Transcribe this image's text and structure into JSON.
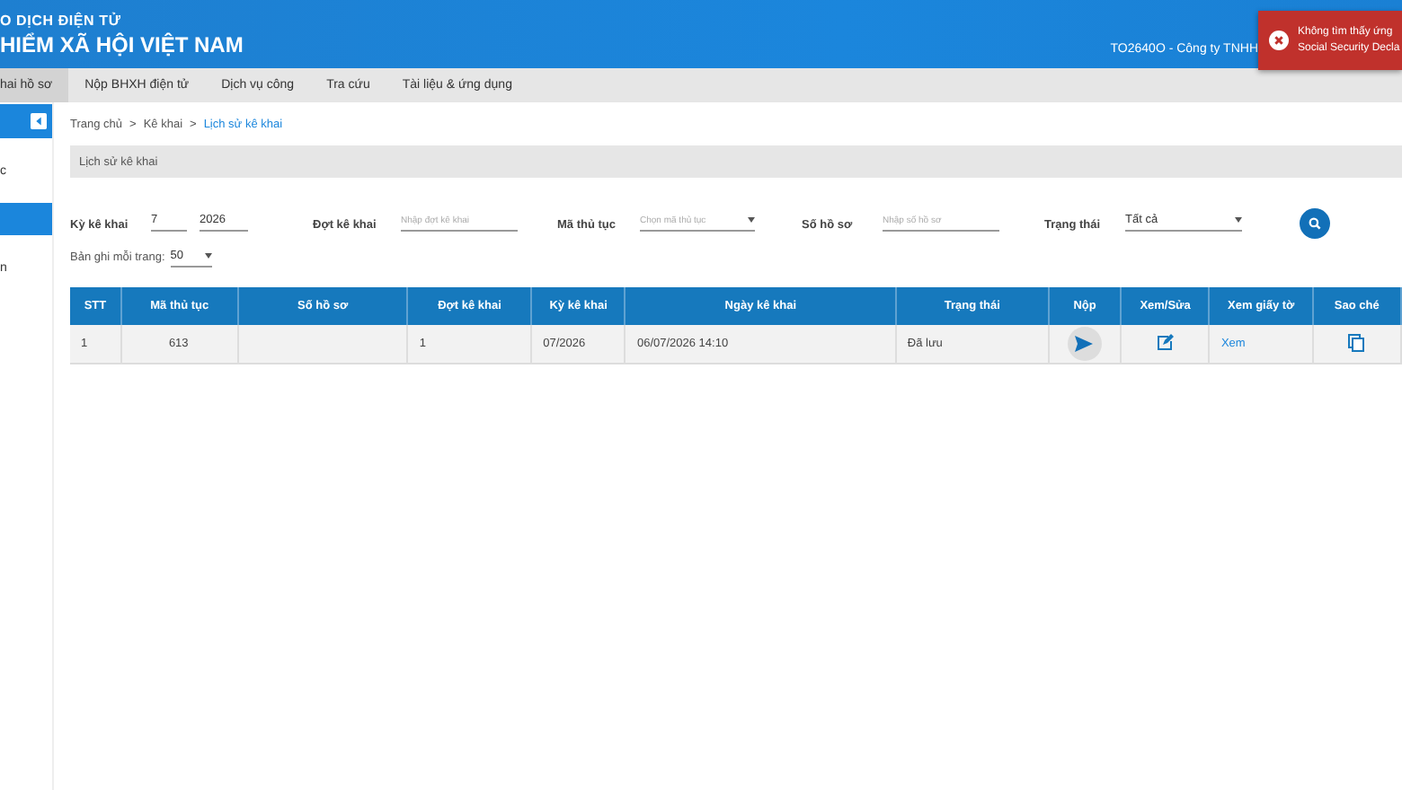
{
  "header": {
    "title_line_1": "O DỊCH ĐIỆN TỬ",
    "title_line_2": "HIỂM XÃ HỘI VIỆT NAM",
    "user": "TO2640O - Công ty TNHH"
  },
  "toast": {
    "line_1": "Không tìm thấy ứng",
    "line_2": "Social Security Decla"
  },
  "nav": [
    {
      "label": "hai hồ sơ",
      "selected": true
    },
    {
      "label": "Nộp BHXH điện tử",
      "selected": false
    },
    {
      "label": "Dịch vụ công",
      "selected": false
    },
    {
      "label": "Tra cứu",
      "selected": false
    },
    {
      "label": "Tài liệu & ứng dụng",
      "selected": false
    }
  ],
  "sidebar": {
    "items": [
      {
        "label": "c",
        "selected": false
      },
      {
        "selected": true
      },
      {
        "label": "n",
        "selected": false
      }
    ]
  },
  "breadcrumb": [
    {
      "label": "Trang chủ",
      "current": false
    },
    {
      "separator": ">",
      "label": "Kê khai",
      "current": false
    },
    {
      "separator": ">",
      "label": "Lịch sử kê khai",
      "current": true
    }
  ],
  "section_title": "Lịch sử kê khai",
  "filters": {
    "period_label": "Kỳ kê khai",
    "period_month": "7",
    "period_year": "2026",
    "batch_label": "Đợt kê khai",
    "batch_placeholder": "Nhập đợt kê khai",
    "procedure_label": "Mã thủ tục",
    "procedure_placeholder": "Chọn mã thủ tục",
    "file_label": "Số hồ sơ",
    "file_placeholder": "Nhập số hồ sơ",
    "status_label": "Trạng thái",
    "status_value": "Tất cả"
  },
  "page_size": {
    "label": "Bản ghi mỗi trang:",
    "value": "50"
  },
  "table": {
    "columns": [
      "STT",
      "Mã thủ tục",
      "Số hồ sơ",
      "Đợt kê khai",
      "Kỳ kê khai",
      "Ngày kê khai",
      "Trạng thái",
      "Nộp",
      "Xem/Sửa",
      "Xem giấy tờ",
      "Sao ché"
    ],
    "rows": [
      {
        "stt": "1",
        "procedure": "613",
        "batch": "1",
        "period": "07/2026",
        "date": "06/07/2026 14:10",
        "status": "Đã lưu",
        "view_link": "Xem"
      }
    ]
  }
}
